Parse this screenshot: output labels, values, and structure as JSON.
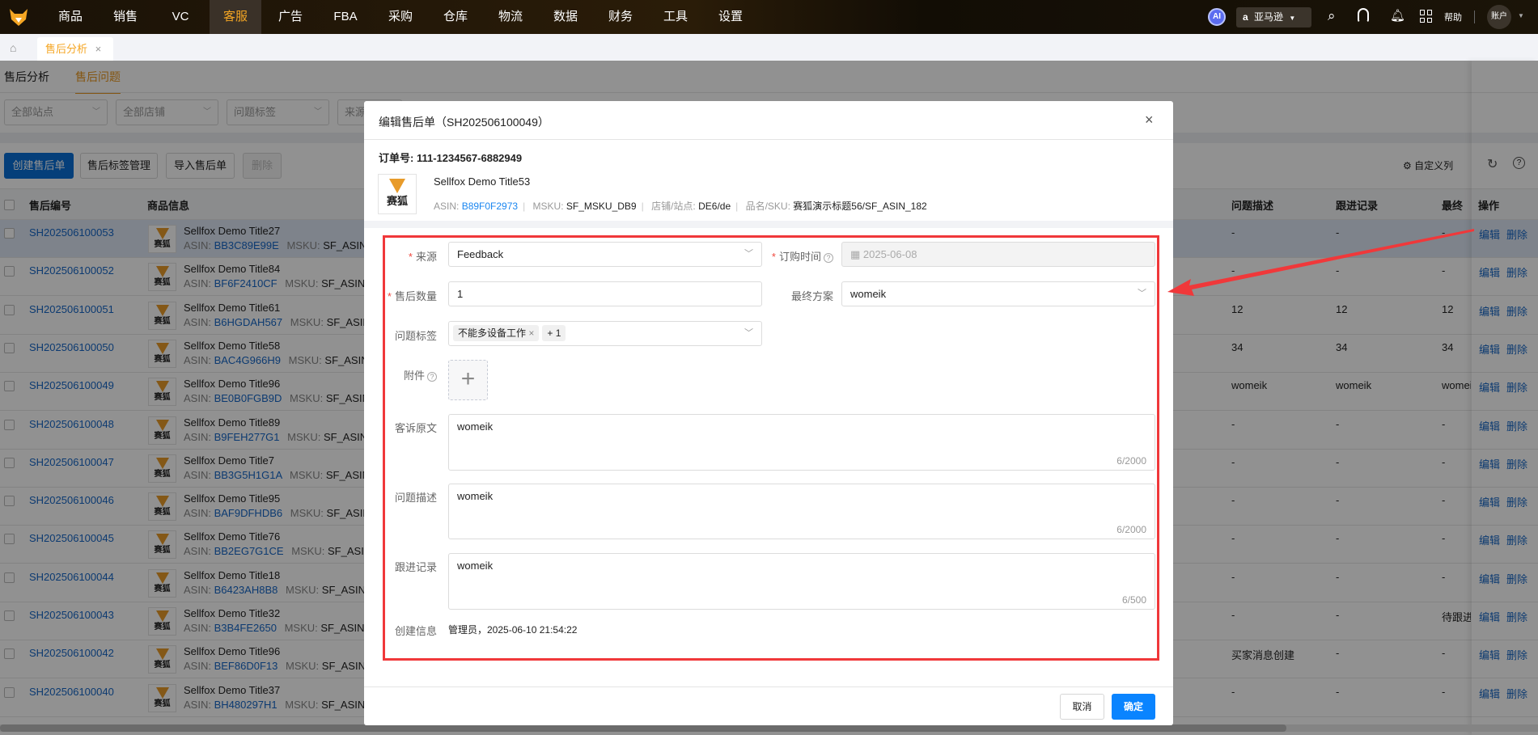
{
  "nav": {
    "items": [
      "商品",
      "销售",
      "VC",
      "客服",
      "广告",
      "FBA",
      "采购",
      "仓库",
      "物流",
      "数据",
      "财务",
      "工具",
      "设置"
    ],
    "active": "客服",
    "ai": "AI",
    "marketplace": "亚马逊",
    "help": "帮助",
    "account": "账户"
  },
  "tabs": {
    "open_tab": "售后分析"
  },
  "page": {
    "subtabs": [
      "售后分析",
      "售后问题"
    ],
    "filters": [
      "全部站点",
      "全部店铺",
      "问题标签",
      "来源"
    ],
    "buttons": {
      "create": "创建售后单",
      "tag_manage": "售后标签管理",
      "import": "导入售后单",
      "delete": "删除"
    },
    "custom_columns": "自定义列",
    "columns": {
      "id": "售后编号",
      "product": "商品信息",
      "desc": "问题描述",
      "follow": "跟进记录",
      "final": "最终方案",
      "ops": "操作"
    },
    "asin_label": "ASIN:",
    "msku_label": "MSKU:",
    "msku_value": "SF_ASIN",
    "edit": "编辑",
    "remove": "删除",
    "rows": [
      {
        "id": "SH202506100053",
        "title": "Sellfox Demo Title27",
        "asin": "BB3C89E99E",
        "desc": "-",
        "follow": "-",
        "final": "-"
      },
      {
        "id": "SH202506100052",
        "title": "Sellfox Demo Title84",
        "asin": "BF6F2410CF",
        "desc": "-",
        "follow": "-",
        "final": "-"
      },
      {
        "id": "SH202506100051",
        "title": "Sellfox Demo Title61",
        "asin": "B6HGDAH567",
        "desc": "12",
        "follow": "12",
        "final": "12"
      },
      {
        "id": "SH202506100050",
        "title": "Sellfox Demo Title58",
        "asin": "BAC4G966H9",
        "desc": "34",
        "follow": "34",
        "final": "34"
      },
      {
        "id": "SH202506100049",
        "title": "Sellfox Demo Title96",
        "asin": "BE0B0FGB9D",
        "desc": "womeik",
        "follow": "womeik",
        "final": "womeik"
      },
      {
        "id": "SH202506100048",
        "title": "Sellfox Demo Title89",
        "asin": "B9FEH277G1",
        "desc": "-",
        "follow": "-",
        "final": "-"
      },
      {
        "id": "SH202506100047",
        "title": "Sellfox Demo Title7",
        "asin": "BB3G5H1G1A",
        "desc": "-",
        "follow": "-",
        "final": "-"
      },
      {
        "id": "SH202506100046",
        "title": "Sellfox Demo Title95",
        "asin": "BAF9DFHDB6",
        "desc": "-",
        "follow": "-",
        "final": "-"
      },
      {
        "id": "SH202506100045",
        "title": "Sellfox Demo Title76",
        "asin": "BB2EG7G1CE",
        "desc": "-",
        "follow": "-",
        "final": "-"
      },
      {
        "id": "SH202506100044",
        "title": "Sellfox Demo Title18",
        "asin": "B6423AH8B8",
        "desc": "-",
        "follow": "-",
        "final": "-"
      },
      {
        "id": "SH202506100043",
        "title": "Sellfox Demo Title32",
        "asin": "B3B4FE2650",
        "desc": "-",
        "follow": "-",
        "final": "待跟进"
      },
      {
        "id": "SH202506100042",
        "title": "Sellfox Demo Title96",
        "asin": "BEF86D0F13",
        "desc": "买家消息创建",
        "follow": "-",
        "final": "-"
      },
      {
        "id": "SH202506100040",
        "title": "Sellfox Demo Title37",
        "asin": "BH480297H1",
        "desc": "-",
        "follow": "-",
        "final": "-"
      }
    ]
  },
  "modal": {
    "title": "编辑售后单（SH202506100049）",
    "order_label": "订单号:",
    "order_no": "111-1234567-6882949",
    "product": {
      "logo_text": "赛狐",
      "title": "Sellfox Demo Title53",
      "asin_label": "ASIN:",
      "asin": "B89F0F2973",
      "msku_label": "MSKU:",
      "msku": "SF_MSKU_DB9",
      "shop_label": "店铺/站点:",
      "shop": "DE6/de",
      "sku_label": "品名/SKU:",
      "sku": "赛狐演示标题56/SF_ASIN_182"
    },
    "form": {
      "source_label": "来源",
      "source": "Feedback",
      "order_time_label": "订购时间",
      "order_time": "2025-06-08",
      "qty_label": "售后数量",
      "qty": "1",
      "final_label": "最终方案",
      "final": "womeik",
      "tags_label": "问题标签",
      "tags": [
        "不能多设备工作"
      ],
      "tags_more": "+ 1",
      "attach_label": "附件",
      "complaint_label": "客诉原文",
      "complaint": "womeik",
      "complaint_count": "6/2000",
      "desc_label": "问题描述",
      "desc": "womeik",
      "desc_count": "6/2000",
      "follow_label": "跟进记录",
      "follow": "womeik",
      "follow_count": "6/500",
      "created_label": "创建信息",
      "created": "管理员，2025-06-10 21:54:22"
    },
    "cancel": "取消",
    "ok": "确定"
  },
  "colors": {
    "brand": "#f5a623",
    "primary": "#0a6fd6",
    "annotation": "#f0383a"
  }
}
